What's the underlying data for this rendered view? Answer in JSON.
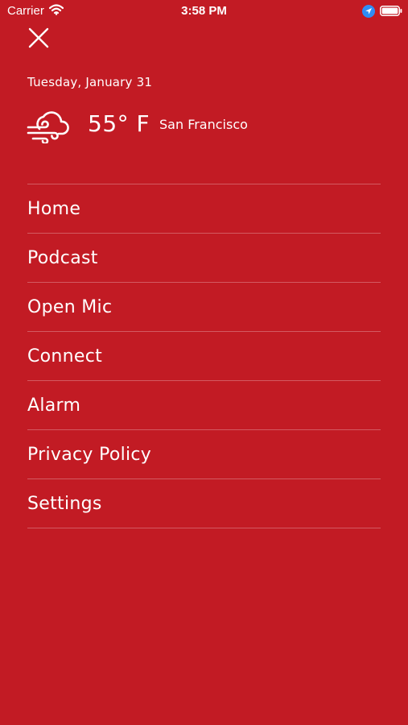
{
  "status_bar": {
    "carrier": "Carrier",
    "time": "3:58 PM"
  },
  "header": {
    "date": "Tuesday, January 31",
    "temperature": "55° F",
    "city": "San Francisco",
    "weather_icon": "wind-cloud-icon"
  },
  "menu": {
    "items": [
      {
        "label": "Home"
      },
      {
        "label": "Podcast"
      },
      {
        "label": "Open Mic"
      },
      {
        "label": "Connect"
      },
      {
        "label": "Alarm"
      },
      {
        "label": "Privacy Policy"
      },
      {
        "label": "Settings"
      }
    ]
  },
  "colors": {
    "background": "#c21b24",
    "text": "#ffffff",
    "divider": "rgba(255,255,255,0.28)"
  }
}
